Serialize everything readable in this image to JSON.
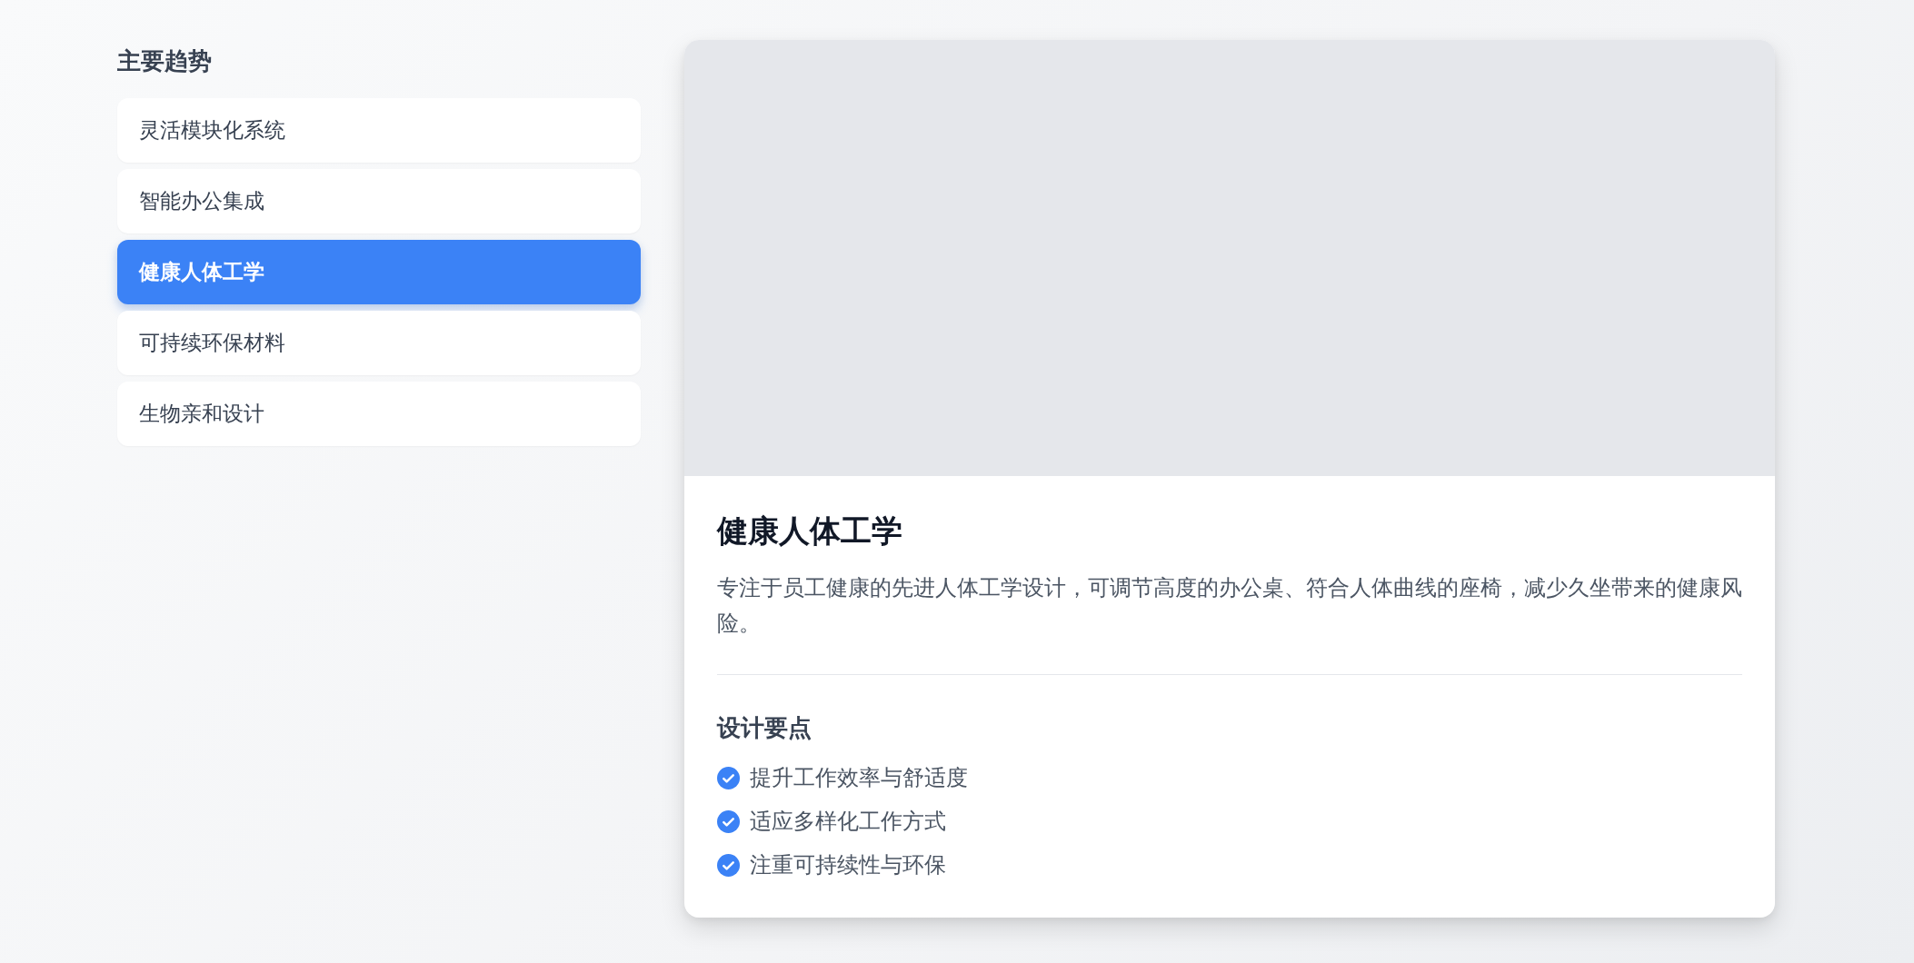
{
  "sidebar": {
    "title": "主要趋势",
    "items": [
      {
        "label": "灵活模块化系统",
        "selected": false
      },
      {
        "label": "智能办公集成",
        "selected": false
      },
      {
        "label": "健康人体工学",
        "selected": true
      },
      {
        "label": "可持续环保材料",
        "selected": false
      },
      {
        "label": "生物亲和设计",
        "selected": false
      }
    ]
  },
  "detail": {
    "title": "健康人体工学",
    "description": "专注于员工健康的先进人体工学设计，可调节高度的办公桌、符合人体曲线的座椅，减少久坐带来的健康风险。",
    "section_title": "设计要点",
    "points": [
      "提升工作效率与舒适度",
      "适应多样化工作方式",
      "注重可持续性与环保"
    ]
  }
}
